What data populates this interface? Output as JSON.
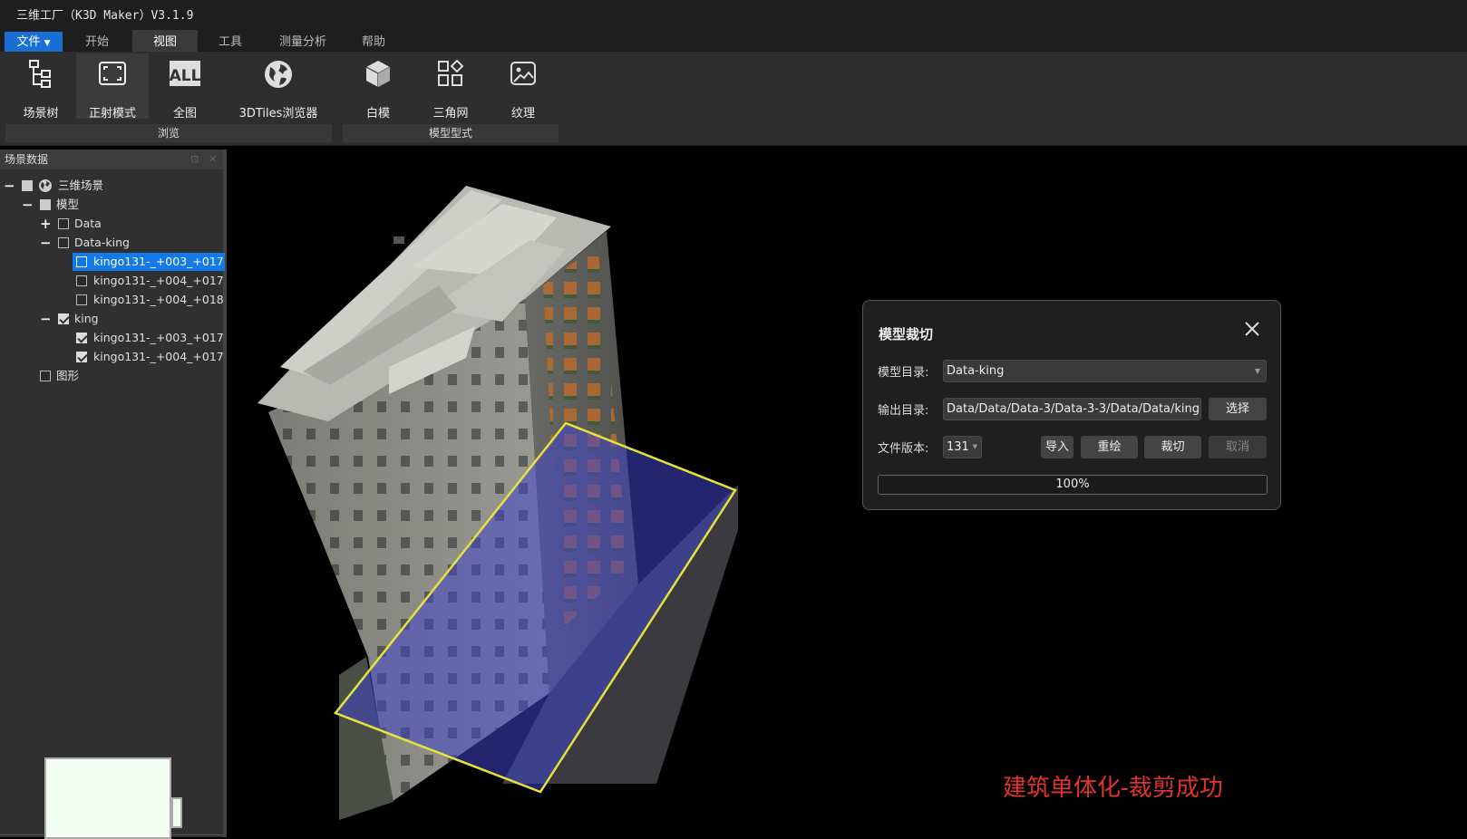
{
  "app": {
    "title": "三维工厂（K3D Maker）V3.1.9"
  },
  "menu": {
    "file": "文件",
    "tabs": [
      "开始",
      "视图",
      "工具",
      "测量分析",
      "帮助"
    ],
    "active_tab": "视图"
  },
  "ribbon": {
    "buttons": [
      "场景树",
      "正射模式",
      "全图",
      "3DTiles浏览器",
      "白模",
      "三角网",
      "纹理"
    ],
    "groups": [
      "浏览",
      "模型型式"
    ]
  },
  "panel": {
    "title": "场景数据"
  },
  "tree": {
    "root": "三维场景",
    "model": "模型",
    "data": "Data",
    "data_king": "Data-king",
    "dk_items": [
      "kingo131-_+003_+017",
      "kingo131-_+004_+017",
      "kingo131-_+004_+018"
    ],
    "king": "king",
    "king_items": [
      "kingo131-_+003_+017",
      "kingo131-_+004_+017"
    ],
    "shapes": "图形"
  },
  "viewport": {
    "caption": "建筑单体化-裁剪成功"
  },
  "dialog": {
    "title": "模型裁切",
    "model_dir_label": "模型目录:",
    "model_dir_value": "Data-king",
    "output_dir_label": "输出目录:",
    "output_dir_value": "Data/Data/Data-3/Data-3-3/Data/Data/king",
    "select_button": "选择",
    "version_label": "文件版本:",
    "version_value": "131",
    "import_button": "导入",
    "redraw_button": "重绘",
    "cut_button": "裁切",
    "cancel_button": "取消",
    "progress_text": "100%",
    "progress": 1.0
  }
}
